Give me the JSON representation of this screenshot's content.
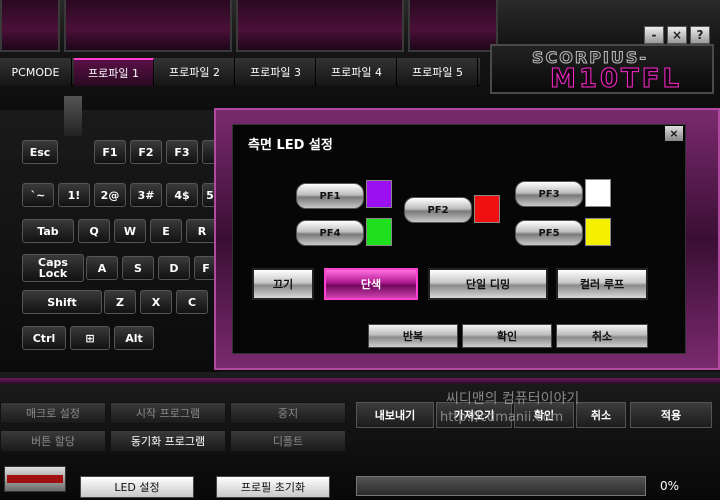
{
  "window": {
    "controls": {
      "minimize": "-",
      "close": "×",
      "help": "?"
    }
  },
  "logo": {
    "line1": "SCORPIUS-",
    "line2": "M10TFL"
  },
  "tabs": [
    {
      "label": "PCMODE",
      "active": false
    },
    {
      "label": "프로파일 1",
      "active": true
    },
    {
      "label": "프로파일 2",
      "active": false
    },
    {
      "label": "프로파일 3",
      "active": false
    },
    {
      "label": "프로파일 4",
      "active": false
    },
    {
      "label": "프로파일 5",
      "active": false
    }
  ],
  "keyboard": {
    "row1": [
      "Esc",
      "F1",
      "F2",
      "F3"
    ],
    "row2": [
      "`~",
      "1!",
      "2@",
      "3#",
      "4$",
      "5"
    ],
    "row3": [
      "Tab",
      "Q",
      "W",
      "E",
      "R"
    ],
    "row4": [
      "Caps Lock",
      "A",
      "S",
      "D",
      "F"
    ],
    "row5": [
      "Shift",
      "Z",
      "X",
      "C"
    ],
    "row6": [
      "Ctrl",
      "⊞",
      "Alt"
    ]
  },
  "dialog": {
    "title": "측면 LED 설정",
    "close": "×",
    "pf_buttons": [
      {
        "label": "PF1",
        "color": "#9a10f0"
      },
      {
        "label": "PF4",
        "color": "#1ee01e"
      },
      {
        "label": "PF2",
        "color": "#f01010"
      },
      {
        "label": "PF3",
        "color": "#ffffff"
      },
      {
        "label": "PF5",
        "color": "#f4f000"
      }
    ],
    "modes": [
      {
        "label": "끄기",
        "selected": false
      },
      {
        "label": "단색",
        "selected": true
      },
      {
        "label": "단일 디밍",
        "selected": false
      },
      {
        "label": "컬러 루프",
        "selected": false
      }
    ],
    "actions": {
      "repeat": "반복",
      "ok": "확인",
      "cancel": "취소"
    }
  },
  "bottom": {
    "left_buttons": [
      {
        "label": "매크로 설정",
        "enabled": false
      },
      {
        "label": "시작 프로그램",
        "enabled": false
      },
      {
        "label": "중지",
        "enabled": false
      },
      {
        "label": "버튼 할당",
        "enabled": false
      },
      {
        "label": "동기화 프로그램",
        "enabled": true
      },
      {
        "label": "디폴트",
        "enabled": false
      }
    ],
    "file_buttons": {
      "export": "내보내기",
      "import": "가져오기",
      "confirm": "확인",
      "cancel": "취소",
      "apply": "적용"
    },
    "led_settings": "LED 설정",
    "profile_reset": "프로필 초기화",
    "progress_percent": 0,
    "progress_text": "0%"
  },
  "watermark": {
    "line1": "씨디맨의 컴퓨터이야기",
    "line2": "http://cdmanii.com"
  }
}
